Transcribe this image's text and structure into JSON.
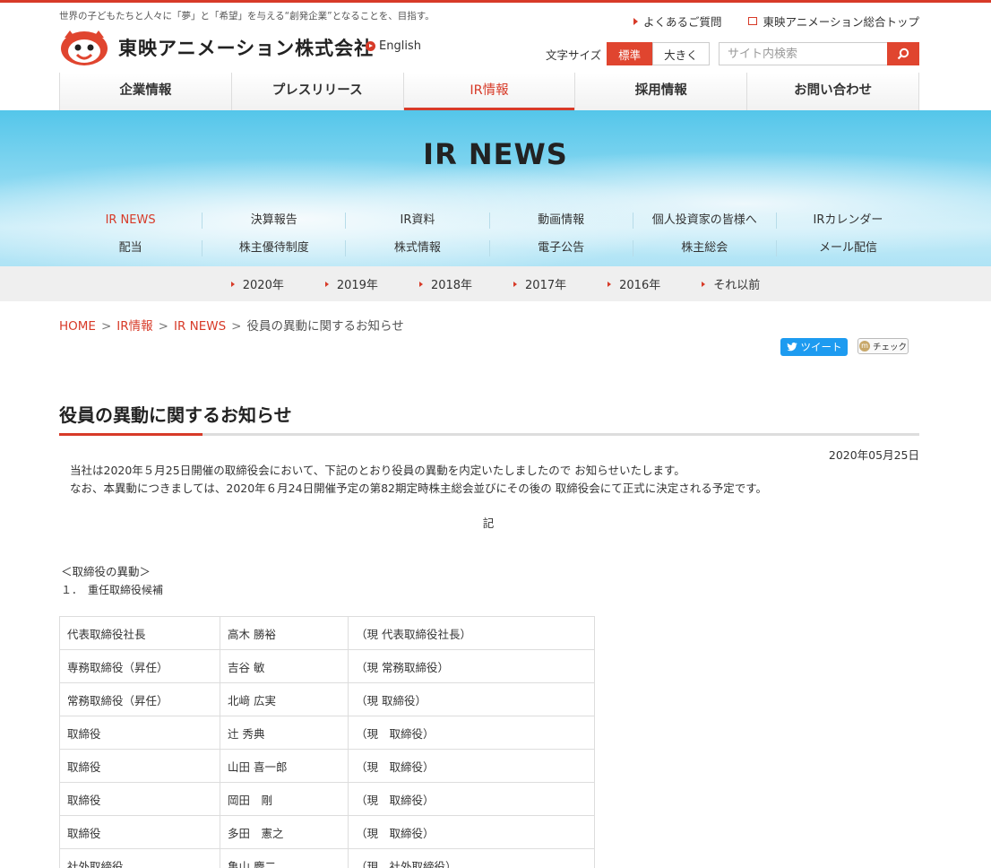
{
  "header": {
    "tagline": "世界の子どもたちと人々に「夢」と「希望」を与える“創発企業”となることを、目指す。",
    "company": "東映アニメーション株式会社",
    "english": "English",
    "faq": "よくあるご質問",
    "corporate_top": "東映アニメーション総合トップ",
    "font_size_label": "文字サイズ",
    "font_standard": "標準",
    "font_large": "大きく",
    "search_placeholder": "サイト内検索"
  },
  "gnav": [
    "企業情報",
    "プレスリリース",
    "IR情報",
    "採用情報",
    "お問い合わせ"
  ],
  "banner": {
    "title": "IR NEWS",
    "subnav_row1": [
      "IR NEWS",
      "決算報告",
      "IR資料",
      "動画情報",
      "個人投資家の皆様へ",
      "IRカレンダー"
    ],
    "subnav_row2": [
      "配当",
      "株主優待制度",
      "株式情報",
      "電子公告",
      "株主総会",
      "メール配信"
    ]
  },
  "years": [
    "2020年",
    "2019年",
    "2018年",
    "2017年",
    "2016年",
    "それ以前"
  ],
  "breadcrumb": {
    "home": "HOME",
    "ir": "IR情報",
    "news": "IR NEWS",
    "current": "役員の異動に関するお知らせ",
    "sep": ">"
  },
  "social": {
    "tweet": "ツイート",
    "check": "チェック"
  },
  "article": {
    "title": "役員の異動に関するお知らせ",
    "date": "2020年05月25日",
    "para1": "当社は2020年５月25日開催の取締役会において、下記のとおり役員の異動を内定いたしましたので お知らせいたします。",
    "para2": "なお、本異動につきましては、2020年６月24日開催予定の第82期定時株主総会並びにその後の 取締役会にて正式に決定される予定です。",
    "ki": "記",
    "section": "＜取締役の異動＞",
    "subsection": "１．　重任取締役候補"
  },
  "table": [
    [
      "代表取締役社長",
      "高木 勝裕",
      "（現 代表取締役社長）"
    ],
    [
      "専務取締役（昇任）",
      "吉谷 敏",
      "（現 常務取締役）"
    ],
    [
      "常務取締役（昇任）",
      "北﨑 広実",
      "（現 取締役）"
    ],
    [
      "取締役",
      "辻 秀典",
      "（現　取締役）"
    ],
    [
      "取締役",
      "山田 喜一郎",
      "（現　取締役）"
    ],
    [
      "取締役",
      "岡田　剛",
      "（現　取締役）"
    ],
    [
      "取締役",
      "多田　憲之",
      "（現　取締役）"
    ],
    [
      "社外取締役",
      "亀山 慶二",
      "（現　社外取締役）"
    ]
  ],
  "colors": {
    "accent": "#d73a28",
    "banner": "#54c6ea"
  }
}
